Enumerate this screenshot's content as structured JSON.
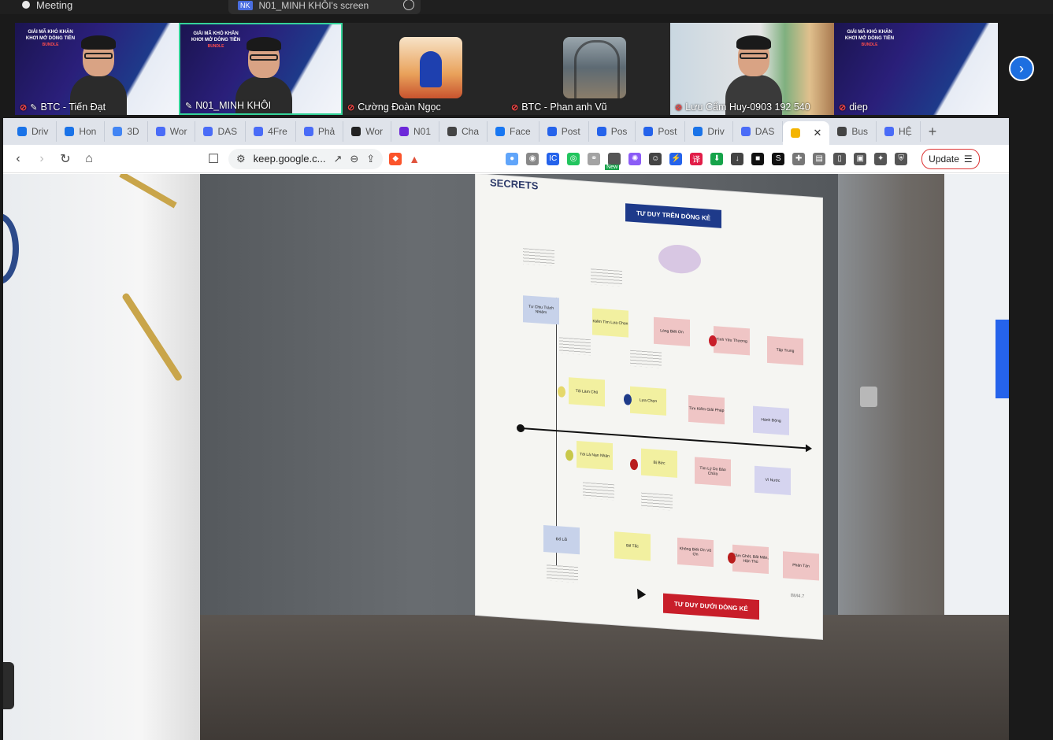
{
  "topbar": {
    "meeting_label": "Meeting",
    "share_badge": "NK",
    "share_label": "N01_MINH KHÔI's screen"
  },
  "participants": [
    {
      "name": "BTC - Tiến Đạt",
      "muted": true,
      "pinned": true
    },
    {
      "name": "N01_MINH KHÔI",
      "muted": false,
      "pinned": true,
      "active": true
    },
    {
      "name": "Cường Đoàn Ngọc",
      "muted": true,
      "pinned": false
    },
    {
      "name": "BTC - Phan anh Vũ",
      "muted": true,
      "pinned": false
    },
    {
      "name": "Lưu Cẩm Huy-0903 192 540",
      "muted": true,
      "pinned": false
    },
    {
      "name": "diep",
      "muted": true,
      "pinned": false
    }
  ],
  "banner": {
    "line1": "GIẢI MÃ KHÓ KHĂN",
    "line2": "KHƠI MỞ DÒNG TIỀN",
    "tag": "BUNDLE"
  },
  "browser": {
    "tabs": [
      {
        "label": "Driv",
        "icon": "drive-icon",
        "color": "#1a73e8"
      },
      {
        "label": "Hon",
        "icon": "drive-icon",
        "color": "#1a73e8"
      },
      {
        "label": "3D",
        "icon": "g-icon",
        "color": "#4285f4"
      },
      {
        "label": "Wor",
        "icon": "doc-icon",
        "color": "#4a6cf7"
      },
      {
        "label": "DAS",
        "icon": "doc-icon",
        "color": "#4a6cf7"
      },
      {
        "label": "4Fre",
        "icon": "doc-icon",
        "color": "#4a6cf7"
      },
      {
        "label": "Phả",
        "icon": "doc-icon",
        "color": "#4a6cf7"
      },
      {
        "label": "Wor",
        "icon": "notion-icon",
        "color": "#222"
      },
      {
        "label": "N01",
        "icon": "chat-icon",
        "color": "#6d28d9"
      },
      {
        "label": "Cha",
        "icon": "openai-icon",
        "color": "#444"
      },
      {
        "label": "Face",
        "icon": "facebook-icon",
        "color": "#1877f2"
      },
      {
        "label": "Post",
        "icon": "zm-icon",
        "color": "#2563eb"
      },
      {
        "label": "Pos",
        "icon": "zm-icon",
        "color": "#2563eb"
      },
      {
        "label": "Post",
        "icon": "zm-icon",
        "color": "#2563eb"
      },
      {
        "label": "Driv",
        "icon": "drive-icon",
        "color": "#1a73e8"
      },
      {
        "label": "DAS",
        "icon": "doc-icon",
        "color": "#4a6cf7"
      }
    ],
    "current_tab": {
      "icon": "keep-icon",
      "color": "#f4b400"
    },
    "after_tabs": [
      {
        "label": "Bus",
        "icon": "openai-icon",
        "color": "#444"
      },
      {
        "label": "HỆ",
        "icon": "doc-icon",
        "color": "#4a6cf7"
      }
    ],
    "url": "keep.google.c...",
    "update_label": "Update",
    "ext_new_badge": "New"
  },
  "board": {
    "logo": "SECRETS",
    "title_top": "TƯ DUY TRÊN DÒNG KẺ",
    "title_bottom": "TƯ DUY DƯỚI DÒNG KẺ",
    "notes_top": [
      "Tự Chịu Trách Nhiệm",
      "Kiếm Tìm Lựa Chọn",
      "Lòng Biết Ơn",
      "Tình Yêu Thương",
      "Tập Trung",
      "Tôi Làm Chủ",
      "Lựa Chọn",
      "Tìm Kiếm Giải Pháp",
      "Hành Động"
    ],
    "notes_bottom": [
      "Đổ Lỗi",
      "Bế Tắc",
      "Không Biết Ơn Vô Ơn",
      "Căm Ghét, Bất Mãn, Hận Thù",
      "Phân Tán",
      "Tôi Là Nạn Nhân",
      "Bị Bức",
      "Tìm Lý Do Bào Chữa",
      "Vì Nước"
    ],
    "corner_text": "BM4.7"
  }
}
